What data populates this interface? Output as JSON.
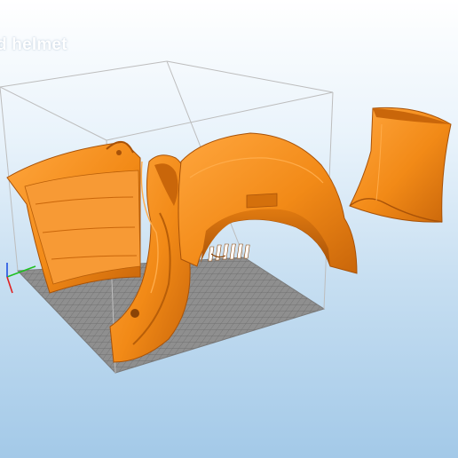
{
  "viewport": {
    "title": "d helmet",
    "background_top": "#ffffff",
    "background_bottom": "#a3c9e8"
  },
  "build_plate": {
    "grid": true,
    "plate_color": "#8f8f8f",
    "grid_line_color": "#6b6b6b",
    "volume_frame_color": "#bdbdbd"
  },
  "axes_gizmo": {
    "x_color": "#e02020",
    "y_color": "#20c020",
    "z_color": "#2050e0"
  },
  "model": {
    "color": "#f28a17",
    "shade_color": "#c9660a",
    "highlight_color": "#ffac4a",
    "parts": [
      "left-cheek-panel",
      "side-ear-piece",
      "helmet-dome-with-vent",
      "neck-back-piece"
    ]
  }
}
